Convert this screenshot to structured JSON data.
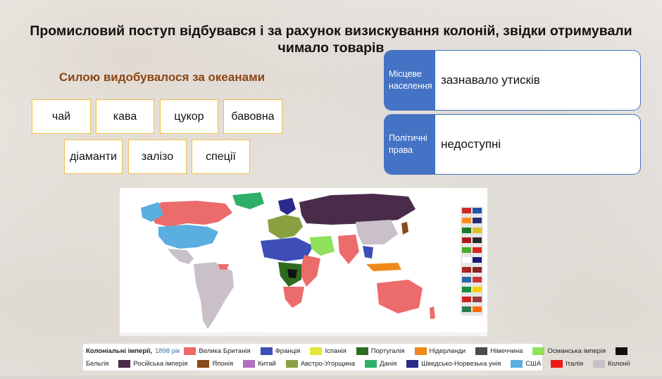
{
  "slide": {
    "title": "Промисловий поступ відбувався і за рахунок визискування колоній, звідки отримували чимало товарів",
    "subtitle": "Силою видобувалося за океанами"
  },
  "goods": [
    "чай",
    "кава",
    "цукор",
    "бавовна",
    "діаманти",
    "залізо",
    "спеції"
  ],
  "info_cards": [
    {
      "label": "Місцеве населення",
      "value": "зазнавало утисків"
    },
    {
      "label": "Політичні права",
      "value": "недоступні"
    }
  ],
  "legend": {
    "title": "Колоніальні імперії,",
    "year": "1898 рік",
    "items_row1": [
      {
        "label": "Велика Британія",
        "color": "#ec6b6b"
      },
      {
        "label": "Франція",
        "color": "#3d4fb6"
      },
      {
        "label": "Іспанія",
        "color": "#e6e63a"
      },
      {
        "label": "Португалія",
        "color": "#2f6b1f"
      },
      {
        "label": "Нідерланди",
        "color": "#ee8a1c"
      },
      {
        "label": "Німеччина",
        "color": "#4b4b4b"
      },
      {
        "label": "Османська імперія",
        "color": "#8fe05a"
      },
      {
        "label": "Бельгія",
        "color": "#111111"
      }
    ],
    "items_row2": [
      {
        "label": "Російська імперія",
        "color": "#4a2c4a"
      },
      {
        "label": "Японія",
        "color": "#8a4a1a"
      },
      {
        "label": "Китай",
        "color": "#b070c0"
      },
      {
        "label": "Австро-Угорщина",
        "color": "#8aa040"
      },
      {
        "label": "Данія",
        "color": "#2fae6a"
      },
      {
        "label": "Шведсько-Норвезька унія",
        "color": "#2a2a8a"
      },
      {
        "label": "США",
        "color": "#5aaee0"
      },
      {
        "label": "Італія",
        "color": "#ee1a1a"
      },
      {
        "label": "Колонії",
        "color": "#c9c0c9"
      }
    ],
    "first_label_row2": "Бельгія"
  },
  "map": {
    "flag_colors": [
      "#cc2a2a",
      "#ff8c1a",
      "#2255aa",
      "#1a7a2a",
      "#e0c020",
      "#aa1a1a",
      "#2a2a2a",
      "#4caa2a",
      "#dd2222",
      "#ffffff",
      "#1a1a7a",
      "#aa2222",
      "#882222",
      "#2a66aa",
      "#cc3333",
      "#1a8a3a",
      "#ffcc00",
      "#cc2222",
      "#9a3a3a",
      "#2a7a4a",
      "#bbbbbb",
      "#ff6a00"
    ]
  }
}
